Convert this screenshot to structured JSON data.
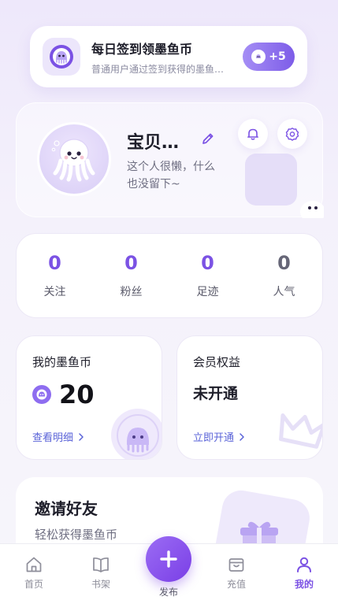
{
  "signin": {
    "title": "每日签到领墨鱼币",
    "subtitle": "普通用户通过签到获得的墨鱼…",
    "reward": "+5"
  },
  "profile": {
    "name": "宝贝…",
    "bio": "这个人很懒，什么也没留下~"
  },
  "stats": [
    {
      "value": "0",
      "label": "关注"
    },
    {
      "value": "0",
      "label": "粉丝"
    },
    {
      "value": "0",
      "label": "足迹"
    },
    {
      "value": "0",
      "label": "人气"
    }
  ],
  "coins": {
    "title": "我的墨鱼币",
    "amount": "20",
    "link": "查看明细"
  },
  "membership": {
    "title": "会员权益",
    "status": "未开通",
    "link": "立即开通"
  },
  "invite": {
    "title": "邀请好友",
    "subtitle": "轻松获得墨鱼币"
  },
  "nav": {
    "home": "首页",
    "bookshelf": "书架",
    "publish": "发布",
    "recharge": "充值",
    "mine": "我的",
    "active": "mine"
  },
  "colors": {
    "accent": "#7b52e4",
    "link": "#5a63d8"
  }
}
